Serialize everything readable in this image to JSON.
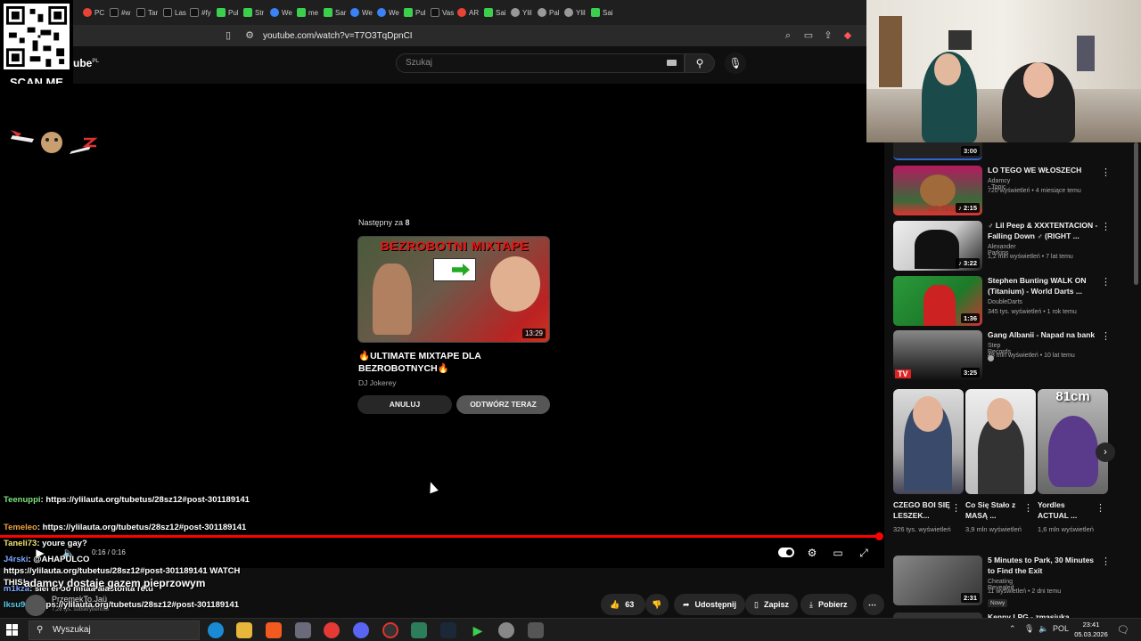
{
  "browser": {
    "tabs": [
      {
        "label": "PC",
        "icon": "c"
      },
      {
        "label": "#w",
        "icon": "tk"
      },
      {
        "label": "Tar",
        "icon": "tk"
      },
      {
        "label": "Las",
        "icon": "tk"
      },
      {
        "label": "#fy",
        "icon": "tk"
      },
      {
        "label": "Pul",
        "icon": "g"
      },
      {
        "label": "Str",
        "icon": "g"
      },
      {
        "label": "We",
        "icon": "b"
      },
      {
        "label": "me",
        "icon": "g"
      },
      {
        "label": "Sar",
        "icon": "g"
      },
      {
        "label": "We",
        "icon": "b"
      },
      {
        "label": "We",
        "icon": "b"
      },
      {
        "label": "Pul",
        "icon": "g"
      },
      {
        "label": "Vas",
        "icon": "tk"
      },
      {
        "label": "AR",
        "icon": "c"
      },
      {
        "label": "Sai",
        "icon": "g"
      },
      {
        "label": "Ylil",
        "icon": "w"
      },
      {
        "label": "Pal",
        "icon": "w"
      },
      {
        "label": "Ylil",
        "icon": "w"
      },
      {
        "label": "Sai",
        "icon": "g"
      }
    ],
    "url": "youtube.com/watch?v=T7O3TqDpnCI"
  },
  "qr_overlay": {
    "caption": "SCAN ME"
  },
  "youtube": {
    "logo_suffix": "ube",
    "country": "PL",
    "search_placeholder": "Szukaj"
  },
  "player": {
    "next_label_prefix": "Następny za",
    "next_countdown": "8",
    "next_thumb_text": "BEZROBOTNI MIXTAPE",
    "next_duration": "13:29",
    "next_title": "🔥ULTIMATE MIXTAPE DLA BEZROBOTNYCH🔥",
    "next_channel": "DJ Jokerey",
    "cancel_label": "ANULUJ",
    "play_now_label": "ODTWÓRZ TERAZ",
    "time": "0:16 / 0:16",
    "progress": 1.0
  },
  "chat": [
    {
      "nick": "Teenuppi",
      "nick_color": "green",
      "text": "https://ylilauta.org/tubetus/28sz12#post-301189141"
    },
    {
      "nick": "Temeleo",
      "nick_color": "orange",
      "text": "https://ylilauta.org/tubetus/28sz12#post-301189141"
    },
    {
      "nick": "Taneli73",
      "nick_color": "yellow",
      "text": "youre gay?"
    },
    {
      "nick": "J4rski",
      "nick_color": "blue",
      "text": "@AHAPULCO https://ylilauta.org/tubetus/28sz12#post-301189141 WATCH THIS!"
    },
    {
      "nick": "m1kza",
      "nick_color": "blue",
      "text": "siel ei oo mitää alastonta rétu"
    },
    {
      "nick": "Iksu99",
      "nick_color": "cyan",
      "text": "https://ylilauta.org/tubetus/28sz12#post-301189141"
    }
  ],
  "video_overlay": {
    "caption": "adamcy dostaje gazem pieprzowym",
    "channel": "PrzemekTo.Jaü",
    "subs": "7,28 tys. subskrybentów"
  },
  "actions": {
    "likes": "63",
    "share": "Udostępnij",
    "save": "Zapisz",
    "download": "Pobierz"
  },
  "sidebar": {
    "top_partial_duration": "3:00",
    "videos": [
      {
        "title": "LO TEGO WE WŁOSZECH",
        "channel": "Adamcy - Topic",
        "meta": "720 wyświetleń • 4 miesiące temu",
        "duration": "2:15",
        "thumb_label": "LO TEGO",
        "short_icon": true
      },
      {
        "title": "♂ Lil Peep & XXXTENTACION - Falling Down ♂ (RIGHT ...",
        "channel": "Alexander Parkins",
        "meta": "1,2 mln wyświetleń • 7 lat temu",
        "duration": "3:22",
        "short_icon": true
      },
      {
        "title": "Stephen Bunting WALK ON (Titanium) - World Darts ...",
        "channel": "DoubleDarts",
        "meta": "345 tys. wyświetleń • 1 rok temu",
        "duration": "1:36"
      },
      {
        "title": "Gang Albanii - Napad na bank",
        "channel": "Step Records",
        "meta": "48 mln wyświetleń • 10 lat temu",
        "duration": "3:25",
        "verified": true,
        "thumb_label": "TV"
      }
    ],
    "shorts": [
      {
        "title": "CZEGO BOI SIĘ LESZEK...",
        "views": "326 tys. wyświetleń"
      },
      {
        "title": "Co Się Stało z MASĄ ...",
        "views": "3,9 mln wyświetleń"
      },
      {
        "title": "Yordles ACTUAL ...",
        "views": "1,6 mln wyświetleń",
        "thumb_label": "81cm"
      }
    ],
    "bottom_video": {
      "title": "5 Minutes to Park, 30 Minutes to Find the Exit",
      "channel": "Cheating Revealed",
      "meta": "11 wyświetleń • 2 dni temu",
      "duration": "2:31",
      "badge": "Nowy"
    },
    "bottom_partial_title": "Kenny LPG - zmasiuka..."
  },
  "taskbar": {
    "search_label": "Wyszukaj",
    "lang": "POL",
    "time": "23:41",
    "date": "05.03.2026"
  }
}
